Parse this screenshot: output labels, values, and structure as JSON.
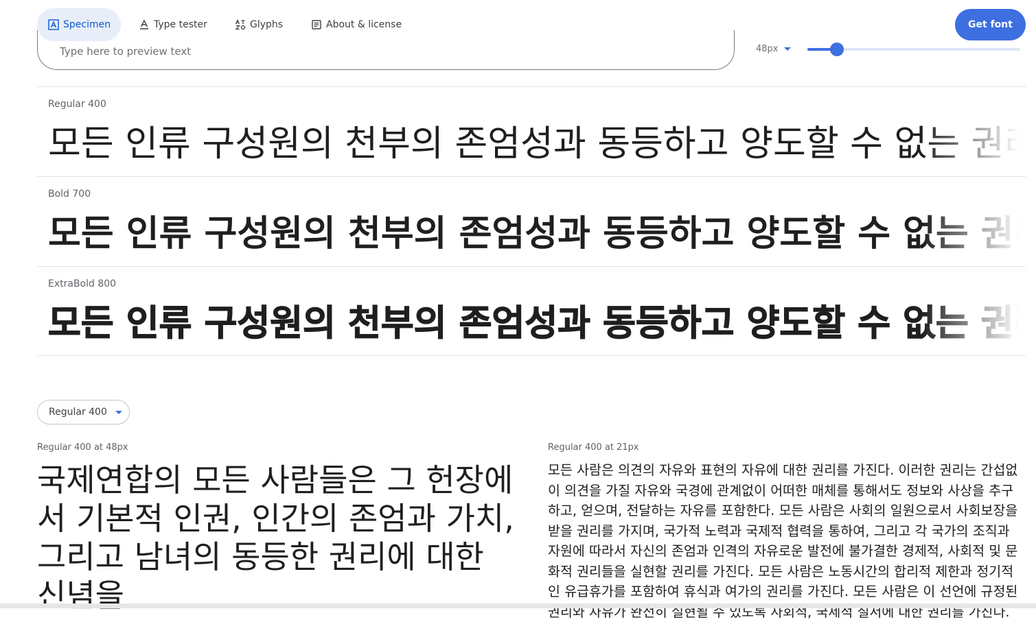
{
  "tabs": [
    {
      "label": "Specimen",
      "icon": "specimen-icon",
      "active": true
    },
    {
      "label": "Type tester",
      "icon": "type-tester-icon",
      "active": false
    },
    {
      "label": "Glyphs",
      "icon": "glyphs-icon",
      "active": false
    },
    {
      "label": "About & license",
      "icon": "about-icon",
      "active": false
    }
  ],
  "get_font_label": "Get font",
  "preview": {
    "placeholder": "Type here to preview text",
    "size": "48px",
    "slider_fraction": 0.14
  },
  "sample_text": "모든 인류 구성원의 천부의 존엄성과 동등하고 양도할 수 없는 권리를 인정하는 것이",
  "styles": [
    {
      "label": "Regular 400"
    },
    {
      "label": "Bold 700"
    },
    {
      "label": "ExtraBold 800"
    }
  ],
  "weight_select": "Regular 400",
  "large_caption": "Regular 400 at 48px",
  "large_paragraph": "국제연합의 모든 사람들은 그 헌장에서 기본적 인권, 인간의 존엄과 가치, 그리고 남녀의 동등한 권리에 대한 신념을",
  "small_caption": "Regular 400 at 21px",
  "small_paragraph": "모든 사람은 의견의 자유와 표현의 자유에 대한 권리를 가진다. 이러한 권리는 간섭없이 의견을 가질 자유와 국경에 관계없이 어떠한 매체를 통해서도 정보와 사상을 추구하고, 얻으며, 전달하는 자유를 포함한다. 모든 사람은 사회의 일원으로서 사회보장을 받을 권리를 가지며, 국가적 노력과 국제적 협력을 통하여, 그리고 각 국가의 조직과 자원에 따라서 자신의 존엄과 인격의 자유로운 발전에 불가결한 경제적, 사회적 및 문화적 권리들을 실현할 권리를 가진다. 모든 사람은 노동시간의 합리적 제한과 정기적인 유급휴가를 포함하여 휴식과 여가의 권리를 가진다. 모든 사람은 이 선언에 규정된 권리와 자유가 완전히 실현될 수 있도록 사회적, 국제적 질서에 대한 권리를 가진다.",
  "colors": {
    "accent": "#3d6fe0",
    "active_tab_bg": "#e8eef9",
    "active_tab_text": "#0b57d0"
  }
}
